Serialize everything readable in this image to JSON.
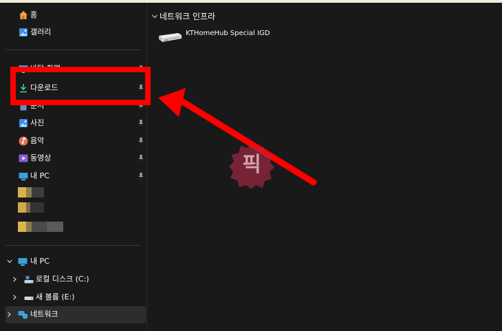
{
  "sidebar": {
    "quick": [
      {
        "label": "홈",
        "icon": "home-icon"
      },
      {
        "label": "갤러리",
        "icon": "gallery-icon"
      }
    ],
    "pinned": [
      {
        "label": "바탕 화면",
        "icon": "desktop-icon"
      },
      {
        "label": "다운로드",
        "icon": "download-icon"
      },
      {
        "label": "문서",
        "icon": "documents-icon"
      },
      {
        "label": "사진",
        "icon": "pictures-icon"
      },
      {
        "label": "음악",
        "icon": "music-icon"
      },
      {
        "label": "동영상",
        "icon": "videos-icon"
      },
      {
        "label": "내 PC",
        "icon": "this-pc-icon"
      }
    ],
    "tree": [
      {
        "label": "내 PC",
        "icon": "this-pc-icon",
        "expanded": true
      },
      {
        "label": "로컬 디스크 (C:)",
        "icon": "local-disk-icon",
        "expanded": false
      },
      {
        "label": "새 볼륨 (E:)",
        "icon": "drive-icon",
        "expanded": false
      },
      {
        "label": "네트워크",
        "icon": "network-icon",
        "expanded": false,
        "selected": true
      }
    ]
  },
  "main": {
    "group_label": "네트워크 인프라",
    "devices": [
      {
        "name": "KTHomeHub Special IGD",
        "icon": "router-icon"
      }
    ]
  },
  "annotation": {
    "watermark_text": "픽"
  },
  "colors": {
    "background": "#191919",
    "annotation": "#ff0000",
    "selected_row": "#2d2d2d"
  }
}
